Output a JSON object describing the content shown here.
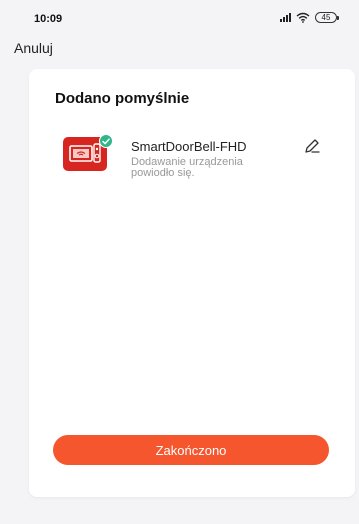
{
  "status_bar": {
    "time": "10:09",
    "battery_level": "45",
    "icons": [
      "signal-icon",
      "wifi-icon",
      "battery-icon"
    ]
  },
  "nav": {
    "cancel_label": "Anuluj"
  },
  "card": {
    "title": "Dodano pomyślnie",
    "device": {
      "name": "SmartDoorBell-FHD",
      "status": "Dodawanie urządzenia powiodło się.",
      "thumbnail_icon": "doorbell-device-icon",
      "badge_icon": "check-icon",
      "edit_icon": "pencil-icon"
    },
    "done_label": "Zakończono"
  },
  "colors": {
    "accent": "#f5562d",
    "device_thumb": "#d6261f",
    "success_badge": "#2fb68a",
    "background": "#f4f4f6"
  }
}
